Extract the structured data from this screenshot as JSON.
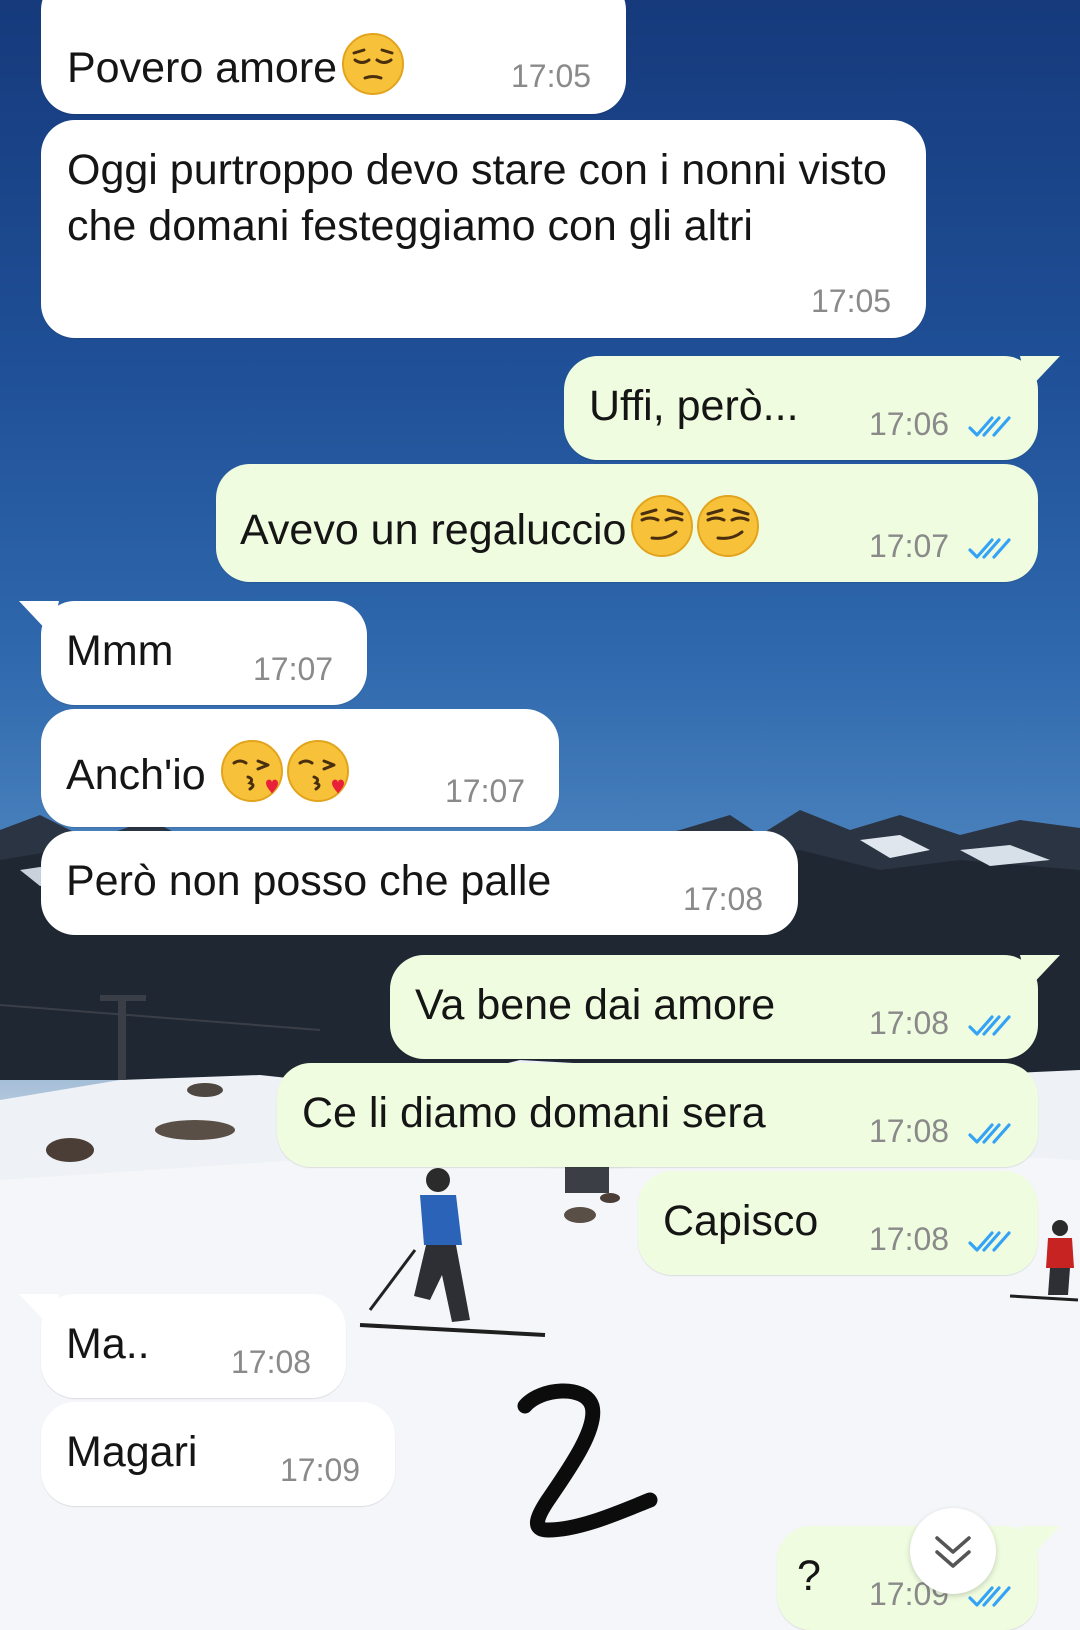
{
  "colors": {
    "incoming_bubble": "#ffffff",
    "outgoing_bubble": "#effcdf",
    "read_ticks": "#34a3f5",
    "timestamp": "#8a8a8a"
  },
  "messages": [
    {
      "direction": "in",
      "text": "Povero amore",
      "emoji": [
        "pensive-face"
      ],
      "time": "17:05"
    },
    {
      "direction": "in",
      "text": "Oggi purtroppo devo stare con i nonni visto che domani festeggiamo con gli altri",
      "time": "17:05"
    },
    {
      "direction": "out",
      "text": "Uffi, però...",
      "time": "17:06",
      "status": "read"
    },
    {
      "direction": "out",
      "text": "Avevo un regaluccio",
      "emoji": [
        "smirking-face",
        "smirking-face"
      ],
      "time": "17:07",
      "status": "read"
    },
    {
      "direction": "in",
      "text": "Mmm",
      "time": "17:07"
    },
    {
      "direction": "in",
      "text": "Anch'io",
      "emoji": [
        "face-blowing-kiss",
        "face-blowing-kiss"
      ],
      "time": "17:07"
    },
    {
      "direction": "in",
      "text": "Però non posso che palle",
      "time": "17:08"
    },
    {
      "direction": "out",
      "text": "Va bene dai amore",
      "time": "17:08",
      "status": "read"
    },
    {
      "direction": "out",
      "text": "Ce li diamo domani sera",
      "time": "17:08",
      "status": "read"
    },
    {
      "direction": "out",
      "text": "Capisco",
      "time": "17:08",
      "status": "read"
    },
    {
      "direction": "in",
      "text": "Ma..",
      "time": "17:08"
    },
    {
      "direction": "in",
      "text": "Magari",
      "time": "17:09"
    },
    {
      "direction": "out",
      "text": "?",
      "time": "17:09",
      "status": "read"
    }
  ],
  "overlay": {
    "scroll_button_icon": "double-chevron-down-icon"
  }
}
